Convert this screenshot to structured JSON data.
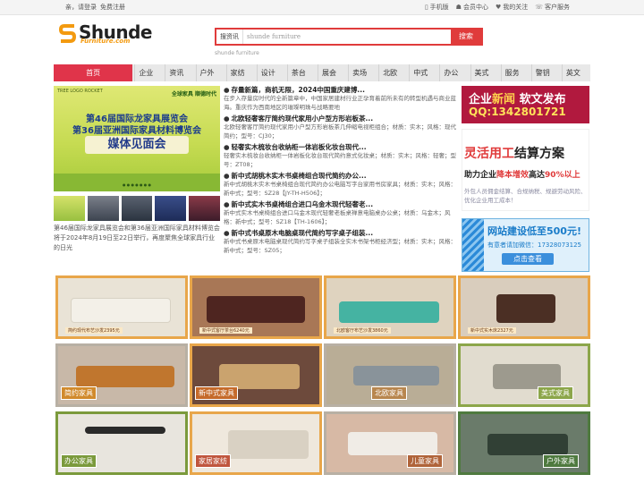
{
  "topbar": {
    "greeting": "亲，请登录",
    "register": "免费注册",
    "links": [
      {
        "icon": "mobile-icon",
        "glyph": "▯",
        "label": "手机版"
      },
      {
        "icon": "member-icon",
        "glyph": "☗",
        "label": "会员中心"
      },
      {
        "icon": "heart-icon",
        "glyph": "♥",
        "label": "我的关注"
      },
      {
        "icon": "phone-icon",
        "glyph": "☏",
        "label": "客户服务"
      }
    ]
  },
  "logo": {
    "word": "Shunde",
    "sub": "Furniture.com"
  },
  "search": {
    "label": "搜资讯",
    "value": "shunde furniture",
    "button": "搜索",
    "hint": "shunde furniture"
  },
  "nav": {
    "home": "首页",
    "items": [
      "企业",
      "资讯",
      "户外",
      "家纺",
      "设计",
      "茶台",
      "展会",
      "卖场",
      "北欧",
      "中式",
      "办公",
      "美式",
      "服务",
      "警钥",
      "英文"
    ]
  },
  "banner": {
    "top_left": "TREE LOGO  ROCKET",
    "top_right": "全球家具 顺德时代",
    "line1": "第46届国际龙家具展览会",
    "line2": "第36届亚洲国际家具材料博览会",
    "line3": "媒体见面会",
    "dots": "● ● ● ● ● ● ●"
  },
  "caption": "第46届国际龙家具展览会和第36届亚洲国际家具材料博览会将于2024年8月19日至22日举行，再度聚焦全球家具行业的日光",
  "news": [
    {
      "title": "存量新篇，商机无限，2024中国重庆建博...",
      "desc": "在步入存量房时代的全新篇章中，中国家居建材行业正孕育着前所未有的转型机遇与商业蓝海。重庆作为西南地区的璀璨明珠与战略要地"
    },
    {
      "title": "北欧轻奢客厅简约现代家用小户型方形岩板茶...",
      "desc": "北欧轻奢客厅简约现代家用小户型方形岩板茶几伸缩电视柜组合；材质：实木；风格：现代简约；型号：CJ30；"
    },
    {
      "title": "轻奢实木梳妆台收纳柜一体岩板化妆台现代...",
      "desc": "轻奢实木梳妆台收纳柜一体岩板化妆台现代简约意式化妆桌；材质：实木；风格：轻奢；型号：ZT08；"
    },
    {
      "title": "新中式胡桃木实木书桌椅组合现代简约办公...",
      "desc": "新中式胡桃木实木书桌椅组合现代简约办公电脑写字台家用书房家具；材质：实木；风格：新中式；型号：SZ28【JY-TH-H506】；"
    },
    {
      "title": "新中式实木书桌椅组合进口乌金木现代轻奢老...",
      "desc": "新中式实木书桌椅组合进口乌金木现代轻奢老板桌禅意电脑桌办公桌；材质：乌金木；风格：新中式；型号：SZ18【TH-1606】；"
    },
    {
      "title": "新中式书桌原木电脑桌现代简约写字桌子组装...",
      "desc": "新中式书桌原木电脑桌现代简约写字桌子组装全实木书架书柜经济型；材质：实木；风格：新中式；型号：SZ05；"
    }
  ],
  "ads": {
    "ad1_l1a": "企业",
    "ad1_l1b": "新闻",
    "ad1_l1c": "软文发布",
    "ad1_l2": "QQ:1342801721",
    "ad2_h1a": "灵活用工",
    "ad2_h1b": "结算方案",
    "ad2_h2a": "助力企业",
    "ad2_h2b": "降本增效",
    "ad2_h2c": "高达",
    "ad2_h2d": "90%以上",
    "ad2_h3": "外包人员佣金结算、合规纳税、规避劳动风险、优化企业用工成本！",
    "ad3_l1": "网站建设低至500元!",
    "ad3_l2": "有意者请加微信：17328073125",
    "ad3_btn": "点击查看"
  },
  "products": [
    {
      "label": "",
      "strip": "简约现代布艺沙发2395元",
      "bg": "#e9e3d6",
      "accent": "#f1ede4",
      "tag_color": ""
    },
    {
      "label": "",
      "strip": "新中式客厅茶台6240元",
      "bg": "#a87756",
      "accent": "#5a2c24",
      "tag_color": ""
    },
    {
      "label": "",
      "strip": "北欧客厅布艺沙发3860元",
      "bg": "#dfd3bf",
      "accent": "#45b3a2",
      "tag_color": ""
    },
    {
      "label": "",
      "strip": "新中式实木床2327元",
      "bg": "#d9cdbd",
      "accent": "#4b2f24",
      "tag_color": ""
    },
    {
      "label": "简约家具",
      "strip": "",
      "bg": "#c8b8a8",
      "accent": "#c0762e",
      "tag_color": "#d18a2c"
    },
    {
      "label": "新中式家具",
      "strip": "",
      "bg": "#6d4a3c",
      "accent": "#caa36e",
      "tag_color": "#c56a2a"
    },
    {
      "label": "北欧家具",
      "strip": "",
      "bg": "#b9ad96",
      "accent": "#89939a",
      "tag_color": "#b8864e"
    },
    {
      "label": "美式家具",
      "strip": "",
      "bg": "#e1dccf",
      "accent": "#9d9a8e",
      "tag_color": "#8ca64a"
    },
    {
      "label": "办公家具",
      "strip": "",
      "bg": "#e8e5de",
      "accent": "#2a2a2a",
      "tag_color": "#7b9a3c"
    },
    {
      "label": "家居家纺",
      "strip": "",
      "bg": "#efe8dd",
      "accent": "#d9d1c3",
      "tag_color": "#c0563e"
    },
    {
      "label": "儿童家具",
      "strip": "",
      "bg": "#d7b9a5",
      "accent": "#f0ece6",
      "tag_color": "#b0643a"
    },
    {
      "label": "户外家具",
      "strip": "",
      "bg": "#6a7b6a",
      "accent": "#314035",
      "tag_color": "#4f7a3f"
    }
  ]
}
